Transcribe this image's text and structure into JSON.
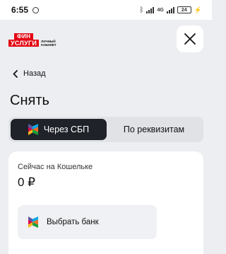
{
  "status_bar": {
    "time": "6:55",
    "network": "4G",
    "battery": "24"
  },
  "header": {
    "logo_top": "ФИН",
    "logo_bottom": "УСЛУГИ",
    "logo_sub": "ЛИЧНЫЙ КАБИНЕТ"
  },
  "nav": {
    "back_label": "Назад"
  },
  "page": {
    "title": "Снять"
  },
  "tabs": [
    {
      "label": "Через СБП",
      "active": true
    },
    {
      "label": "По реквизитам",
      "active": false
    }
  ],
  "wallet": {
    "label": "Сейчас на Кошельке",
    "amount": "0 ₽"
  },
  "bank_button": {
    "label": "Выбрать банк"
  },
  "colors": {
    "brand_red": "#e30613",
    "tab_active_bg": "#1f2229",
    "page_bg": "#eceef1"
  }
}
